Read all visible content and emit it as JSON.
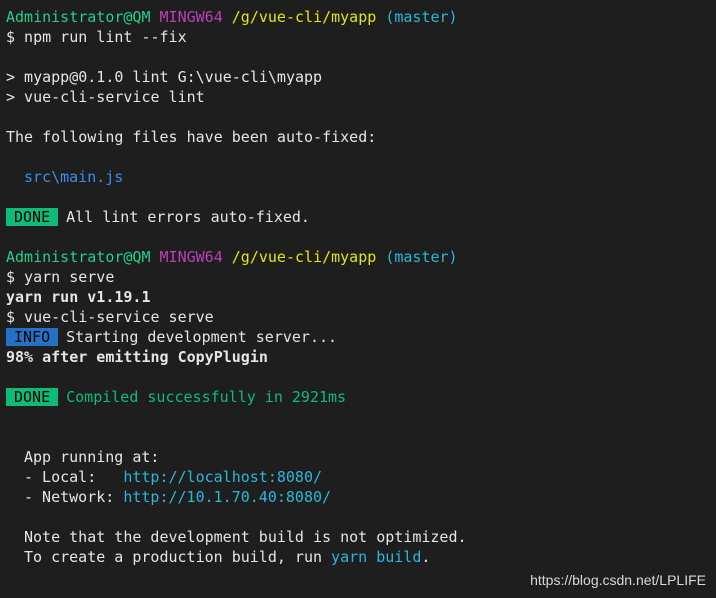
{
  "prompt1": {
    "user": "Administrator@QM",
    "shell": "MINGW64",
    "path": "/g/vue-cli/myapp",
    "branch": "(master)"
  },
  "cmd1": "$ npm run lint --fix",
  "lint_output": [
    "> myapp@0.1.0 lint G:\\vue-cli\\myapp",
    "> vue-cli-service lint"
  ],
  "autofix_heading": "The following files have been auto-fixed:",
  "fixed_file": "src\\main.js",
  "done1": {
    "badge": "DONE",
    "message": "All lint errors auto-fixed."
  },
  "prompt2": {
    "user": "Administrator@QM",
    "shell": "MINGW64",
    "path": "/g/vue-cli/myapp",
    "branch": "(master)"
  },
  "cmd2": "$ yarn serve",
  "yarn_version": "yarn run v1.19.1",
  "cmd3": "$ vue-cli-service serve",
  "info": {
    "badge": "INFO",
    "message": "Starting development server..."
  },
  "progress": "98% after emitting CopyPlugin",
  "done2": {
    "badge": "DONE",
    "message": "Compiled successfully in 2921ms"
  },
  "app_running": "App running at:",
  "local": {
    "label": "- Local:   ",
    "url": "http://localhost:8080/"
  },
  "network": {
    "label": "- Network: ",
    "url": "http://10.1.70.40:8080/"
  },
  "note1": "Note that the development build is not optimized.",
  "note2": {
    "prefix": "To create a production build, run ",
    "command": "yarn build",
    "suffix": "."
  },
  "watermark": "https://blog.csdn.net/LPLIFE",
  "colors": {
    "background": "#1e1e1e",
    "prompt_user": "#23d18b",
    "prompt_shell": "#bc3fbc",
    "prompt_path": "#e5e510",
    "prompt_branch": "#29b8db",
    "badge_done": "#0dbc79",
    "badge_info": "#2472c8",
    "link": "#29b8db"
  }
}
